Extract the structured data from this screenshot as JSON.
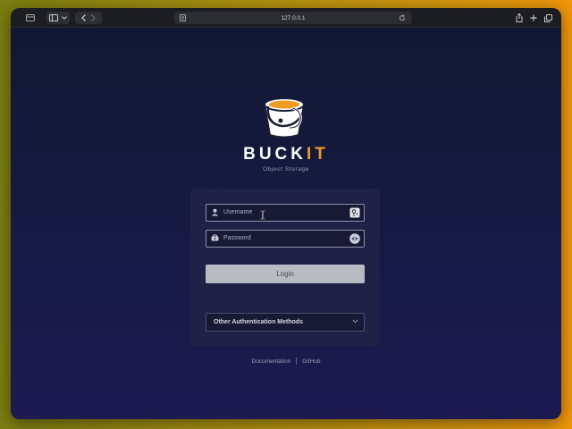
{
  "browser": {
    "url": "127.0.0.1"
  },
  "app": {
    "name_main": "BUCK",
    "name_accent": "IT",
    "subtitle": "Object Storage",
    "accent_color": "#f29a1f"
  },
  "login_form": {
    "username": {
      "placeholder": "Username",
      "value": ""
    },
    "password": {
      "placeholder": "Password",
      "value": ""
    },
    "login_button": "Login",
    "other_methods": "Other Authentication Methods"
  },
  "footer": {
    "links": [
      "Documentation",
      "GitHub"
    ]
  },
  "icons": {
    "username_field": "user-icon",
    "password_field": "key-icon",
    "username_trailing": "password-manager-icon",
    "password_trailing": "eye-icon"
  }
}
